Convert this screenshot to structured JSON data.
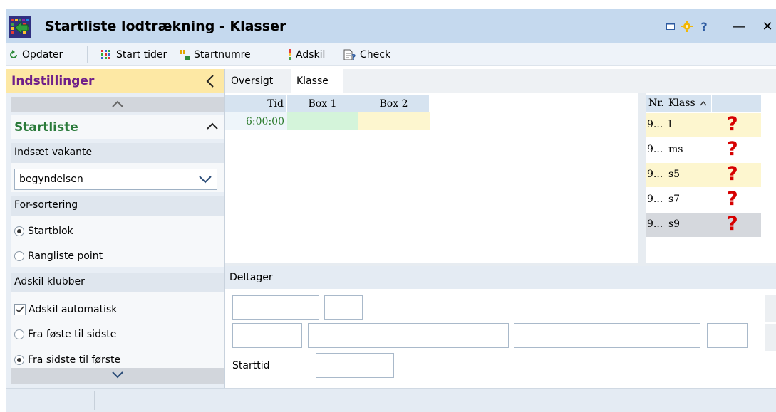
{
  "window": {
    "title": "Startliste lodtrækning - Klasser",
    "controls": {
      "help": "?",
      "minimize": "—",
      "close": "✕"
    }
  },
  "toolbar": {
    "refresh": "Opdater",
    "start_times": "Start tider",
    "start_numbers": "Startnumre",
    "separate": "Adskil",
    "check": "Check"
  },
  "settings_panel": {
    "title": "Indstillinger",
    "section_title": "Startliste",
    "insert_vacant_label": "Indsæt vakante",
    "insert_vacant_value": "begyndelsen",
    "presort_label": "For-sortering",
    "presort_options": [
      {
        "label": "Startblok",
        "selected": true
      },
      {
        "label": "Rangliste point",
        "selected": false
      }
    ],
    "separate_clubs_label": "Adskil klubber",
    "auto_separate": {
      "label": "Adskil automatisk",
      "checked": true
    },
    "order_options": [
      {
        "label": "Fra føste til sidste",
        "selected": false
      },
      {
        "label": "Fra sidste til første",
        "selected": true
      }
    ]
  },
  "tabs": [
    "Oversigt",
    "Klasse"
  ],
  "start_grid": {
    "columns": [
      "Tid",
      "Box 1",
      "Box 2"
    ],
    "rows": [
      {
        "time": "6:00:00"
      }
    ],
    "colors": {
      "box1": "#d4f4da",
      "box2": "#fdf6cf",
      "time": "#2a7a2a"
    }
  },
  "class_list": {
    "columns": {
      "nr": "Nr.",
      "class": "Klass"
    },
    "rows": [
      {
        "nr": "9...",
        "name": "l",
        "status": "?"
      },
      {
        "nr": "9...",
        "name": "ms",
        "status": "?"
      },
      {
        "nr": "9...",
        "name": "s5",
        "status": "?"
      },
      {
        "nr": "9...",
        "name": "s7",
        "status": "?"
      },
      {
        "nr": "9...",
        "name": "s9",
        "status": "?"
      }
    ]
  },
  "participant": {
    "title": "Deltager",
    "start_time_label": "Starttid"
  }
}
